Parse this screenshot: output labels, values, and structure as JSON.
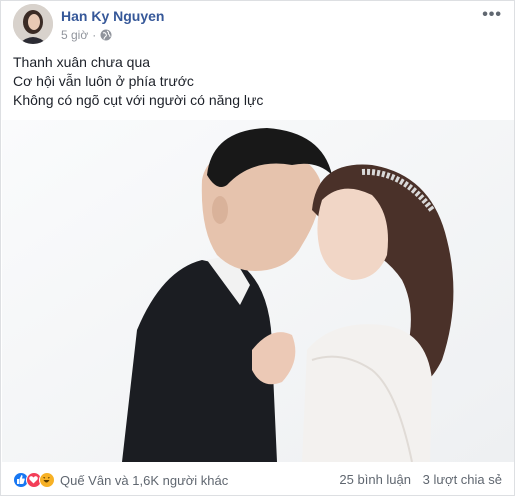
{
  "post": {
    "author": "Han Ky Nguyen",
    "time": "5 giờ",
    "privacy_icon": "globe-icon",
    "more_icon": "more-icon",
    "lines": [
      "Thanh xuân chưa qua",
      "Cơ hội vẫn luôn ở phía trước",
      "Không có ngõ cụt với người có năng lực"
    ]
  },
  "footer": {
    "reactions_label": "Quế Vân và 1,6K người khác",
    "comments": "25 bình luận",
    "shares": "3 lượt chia sẻ",
    "reaction_icons": [
      "like-icon",
      "love-icon",
      "haha-icon"
    ]
  },
  "colors": {
    "author": "#365899",
    "meta": "#90949c",
    "like": "#1877f2",
    "love": "#f33e58",
    "haha": "#f7b125"
  }
}
